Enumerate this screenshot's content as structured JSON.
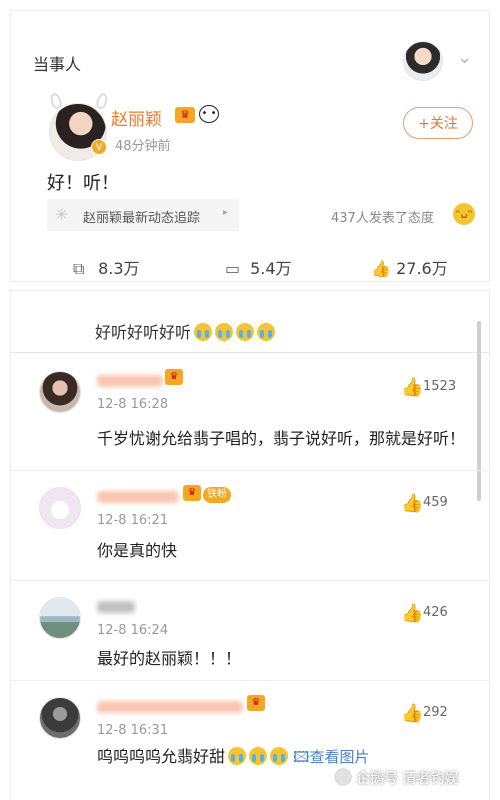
{
  "post_card": {
    "section_title": "当事人",
    "author_name": "赵丽颖",
    "post_time": "48分钟前",
    "follow_label": "+关注",
    "post_text": "好！听！",
    "track_label": "赵丽颖最新动态追踪",
    "attitude_text": "437人发表了态度",
    "repost_count": "8.3万",
    "comment_count": "5.4万",
    "like_count": "27.6万"
  },
  "comments_card": {
    "reply_text": "好听好听好听",
    "comments": [
      {
        "name": "",
        "time": "12-8 16:28",
        "likes": "1523",
        "text": "千岁忧谢允给翡子唱的，翡子说好听，那就是好听！"
      },
      {
        "name": "",
        "badge_label": "铁粉",
        "time": "12-8 16:21",
        "likes": "459",
        "text": "你是真的快"
      },
      {
        "name": "",
        "time": "12-8 16:24",
        "likes": "426",
        "text": "最好的赵丽颖！！！"
      },
      {
        "name": "",
        "time": "12-8 16:31",
        "likes": "292",
        "text": "呜呜呜呜允翡好甜",
        "image_link": "查看图片"
      }
    ]
  },
  "watermark": "企鹅号 清者钓娱",
  "colors": {
    "accent_orange": "#ec7b2c",
    "badge_gold": "#f6a623",
    "link_blue": "#4a7fbf"
  },
  "icons": [
    "chevron-down-icon",
    "v-verified-icon",
    "crown-icon",
    "panda-icon",
    "track-icon",
    "laugh-emoji-icon",
    "repost-icon",
    "comment-icon",
    "like-icon",
    "cry-emoji-icon",
    "image-icon"
  ]
}
